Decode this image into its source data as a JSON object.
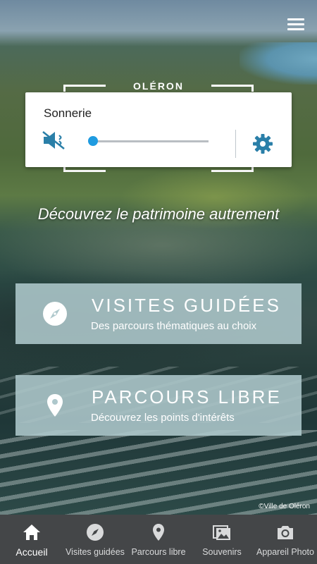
{
  "brand": "OLÉRON",
  "sound_panel": {
    "title": "Sonnerie",
    "volume_level": 0.0,
    "mute_icon": "speaker-muted-icon",
    "settings_icon": "gear-icon"
  },
  "tagline": "Découvrez le patrimoine autrement",
  "buttons": [
    {
      "title": "VISITES GUIDÉES",
      "subtitle": "Des parcours thématiques au choix",
      "icon": "compass-icon"
    },
    {
      "title": "PARCOURS LIBRE",
      "subtitle": "Découvrez les points d'intérêts",
      "icon": "map-pin-icon"
    }
  ],
  "copyright": "©Ville de Oléron",
  "tabs": [
    {
      "label": "Accueil",
      "icon": "home-icon",
      "active": true
    },
    {
      "label": "Visites guidées",
      "icon": "compass-icon"
    },
    {
      "label": "Parcours libre",
      "icon": "map-pin-icon"
    },
    {
      "label": "Souvenirs",
      "icon": "photos-icon"
    },
    {
      "label": "Appareil Photo",
      "icon": "camera-icon"
    }
  ],
  "colors": {
    "accent": "#1f9be0",
    "button_bg": "#aec8cc",
    "tabbar_bg": "#444648",
    "icon_blue": "#2a7fa8"
  }
}
